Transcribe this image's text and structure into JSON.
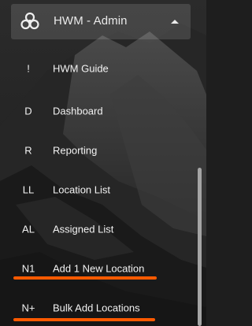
{
  "header": {
    "title": "HWM - Admin",
    "icon": "biohazard-icon"
  },
  "menu": {
    "items": [
      {
        "abbr": "!",
        "label": "HWM Guide"
      },
      {
        "abbr": "D",
        "label": "Dashboard"
      },
      {
        "abbr": "R",
        "label": "Reporting"
      },
      {
        "abbr": "LL",
        "label": "Location List"
      },
      {
        "abbr": "AL",
        "label": "Assigned List"
      },
      {
        "abbr": "N1",
        "label": "Add 1 New Location"
      },
      {
        "abbr": "N+",
        "label": "Bulk Add Locations"
      }
    ]
  },
  "colors": {
    "highlight": "#ff5a00",
    "text": "#f2f2f2",
    "header_bg": "#3a3a3a"
  }
}
